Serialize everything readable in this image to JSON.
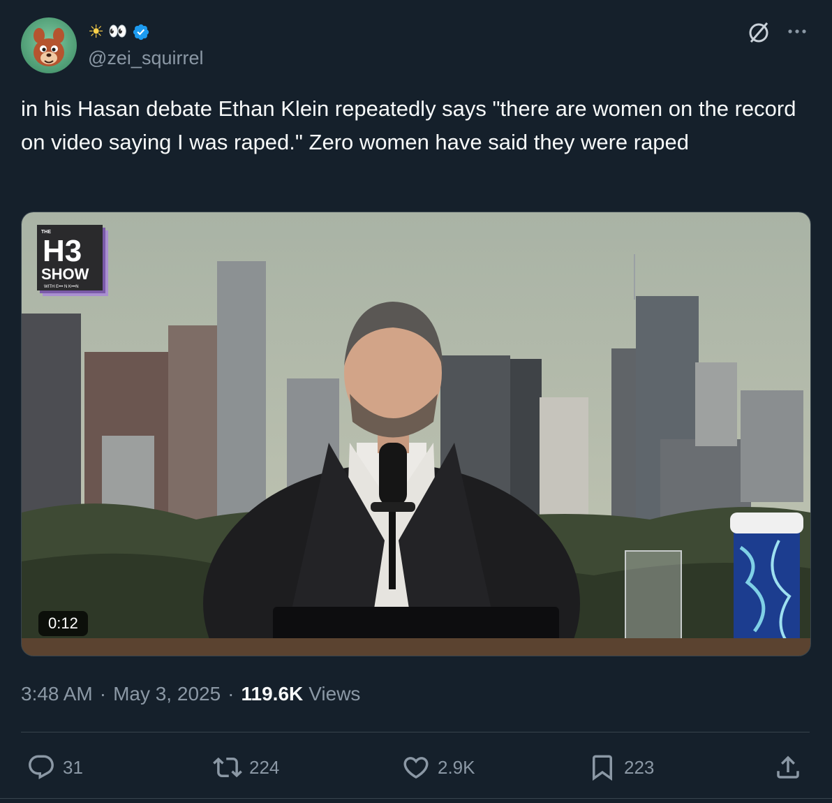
{
  "author": {
    "display_name_emoji": "☀",
    "display_name_eyes": "👀",
    "handle": "@zei_squirrel",
    "avatar_icon": "squirrel-avatar",
    "verified_icon": "verified-badge-icon",
    "verified_color": "#1d9bf0"
  },
  "header_icons": {
    "grok": "grok-icon",
    "more": "more-icon"
  },
  "tweet": {
    "text": "in his Hasan debate Ethan Klein repeatedly says \"there are women on the record on video saying I was raped.\" Zero women have said they were raped"
  },
  "media": {
    "logo_the": "THE",
    "logo_h3": "H3",
    "logo_show": "SHOW",
    "logo_sub": "WITH E••• N K•••N",
    "duration": "0:12"
  },
  "meta": {
    "time": "3:48 AM",
    "date": "May 3, 2025",
    "views_count": "119.6K",
    "views_label": "Views"
  },
  "actions": {
    "replies": "31",
    "reposts": "224",
    "likes": "2.9K",
    "bookmarks": "223"
  },
  "colors": {
    "background": "#15202b",
    "text": "#f7f9f9",
    "muted": "#8b98a5",
    "border": "#38444d"
  }
}
